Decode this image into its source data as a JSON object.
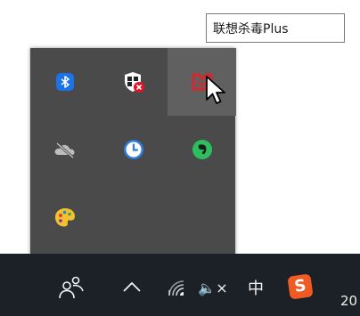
{
  "tooltip": {
    "text": "联想杀毒Plus"
  },
  "tray_overflow": {
    "icons": [
      {
        "name": "bluetooth-icon",
        "color": "#1a73e8"
      },
      {
        "name": "windows-security-warning-icon",
        "color": "#e81123"
      },
      {
        "name": "lenovo-antivirus-icon",
        "color": "#d7262e"
      },
      {
        "name": "onedrive-offline-icon",
        "color": "#bdbdbd"
      },
      {
        "name": "clock-app-icon",
        "color": "#2f7de1"
      },
      {
        "name": "evernote-icon",
        "color": "#2dbe60"
      },
      {
        "name": "palette-app-icon",
        "color": "#f2c12e"
      }
    ]
  },
  "taskbar": {
    "people_icon": "people-icon",
    "show_hidden_icon": "chevron-up-icon",
    "network_icon": "wifi-icon",
    "volume_label": "🔈×",
    "ime_label": "中",
    "sogou_label": "S",
    "clock_text": "20"
  }
}
